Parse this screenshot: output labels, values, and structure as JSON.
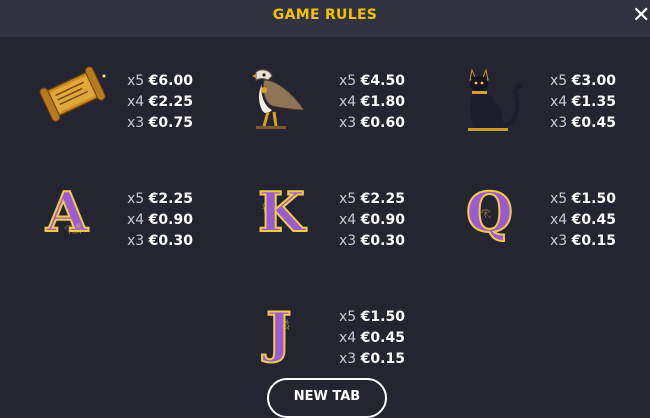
{
  "header": {
    "title": "GAME RULES",
    "close_icon": "close-icon"
  },
  "colors": {
    "accent": "#f2c200",
    "background": "#252531",
    "header": "#323240"
  },
  "symbols": [
    {
      "name": "scroll",
      "pays": [
        {
          "mult": "x5",
          "amt": "€6.00"
        },
        {
          "mult": "x4",
          "amt": "€2.25"
        },
        {
          "mult": "x3",
          "amt": "€0.75"
        }
      ]
    },
    {
      "name": "falcon",
      "pays": [
        {
          "mult": "x5",
          "amt": "€4.50"
        },
        {
          "mult": "x4",
          "amt": "€1.80"
        },
        {
          "mult": "x3",
          "amt": "€0.60"
        }
      ]
    },
    {
      "name": "cat",
      "pays": [
        {
          "mult": "x5",
          "amt": "€3.00"
        },
        {
          "mult": "x4",
          "amt": "€1.35"
        },
        {
          "mult": "x3",
          "amt": "€0.45"
        }
      ]
    },
    {
      "name": "A",
      "letter": "A",
      "pays": [
        {
          "mult": "x5",
          "amt": "€2.25"
        },
        {
          "mult": "x4",
          "amt": "€0.90"
        },
        {
          "mult": "x3",
          "amt": "€0.30"
        }
      ]
    },
    {
      "name": "K",
      "letter": "K",
      "pays": [
        {
          "mult": "x5",
          "amt": "€2.25"
        },
        {
          "mult": "x4",
          "amt": "€0.90"
        },
        {
          "mult": "x3",
          "amt": "€0.30"
        }
      ]
    },
    {
      "name": "Q",
      "letter": "Q",
      "pays": [
        {
          "mult": "x5",
          "amt": "€1.50"
        },
        {
          "mult": "x4",
          "amt": "€0.45"
        },
        {
          "mult": "x3",
          "amt": "€0.15"
        }
      ]
    },
    {
      "name": "J",
      "letter": "J",
      "pays": [
        {
          "mult": "x5",
          "amt": "€1.50"
        },
        {
          "mult": "x4",
          "amt": "€0.45"
        },
        {
          "mult": "x3",
          "amt": "€0.15"
        }
      ]
    }
  ],
  "footer": {
    "new_tab_label": "NEW TAB"
  }
}
